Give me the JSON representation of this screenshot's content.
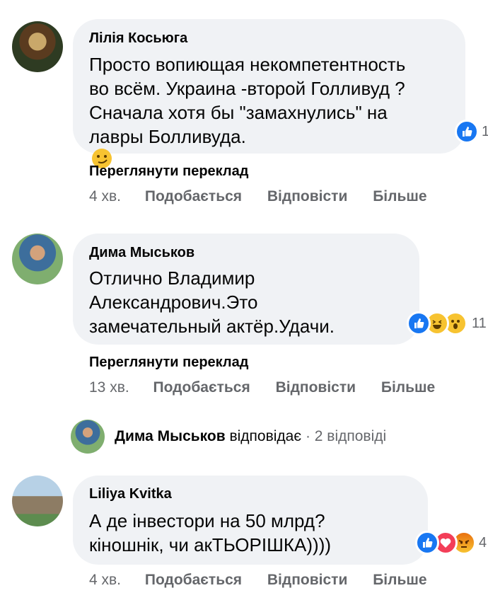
{
  "comments": [
    {
      "author": "Лілія Косьюга",
      "lines": [
        "Просто вопиющая некомпетентность",
        "во всём. Украина -второй Голливуд ?",
        "Сначала хотя бы \"замахнулись\" на",
        "лавры Болливуда."
      ],
      "emoji": "smirking-face",
      "reaction_count": "1",
      "translate": "Переглянути переклад",
      "time": "4 хв.",
      "like": "Подобається",
      "reply": "Відповісти",
      "more": "Більше"
    },
    {
      "author": "Дима Мыськов",
      "lines": [
        "Отлично Владимир",
        "Александрович.Это",
        "замечательный актёр.Удачи."
      ],
      "reaction_count": "11",
      "translate": "Переглянути переклад",
      "time": "13 хв.",
      "like": "Подобається",
      "reply": "Відповісти",
      "more": "Більше"
    },
    {
      "author": "Liliya Kvitka",
      "lines": [
        "А де інвестори на 50 млрд?",
        "кіношнік, чи акТЬОРІШКА))))"
      ],
      "reaction_count": "4",
      "time": "4 хв.",
      "like": "Подобається",
      "reply": "Відповісти",
      "more": "Більше"
    }
  ],
  "reply_summary": {
    "author": "Дима Мыськов",
    "action": "відповідає",
    "separator": "·",
    "count": "2 відповіді"
  },
  "colors": {
    "bubble": "#f0f2f5",
    "secondary_text": "#65676b",
    "like_blue": "#1877f2"
  }
}
